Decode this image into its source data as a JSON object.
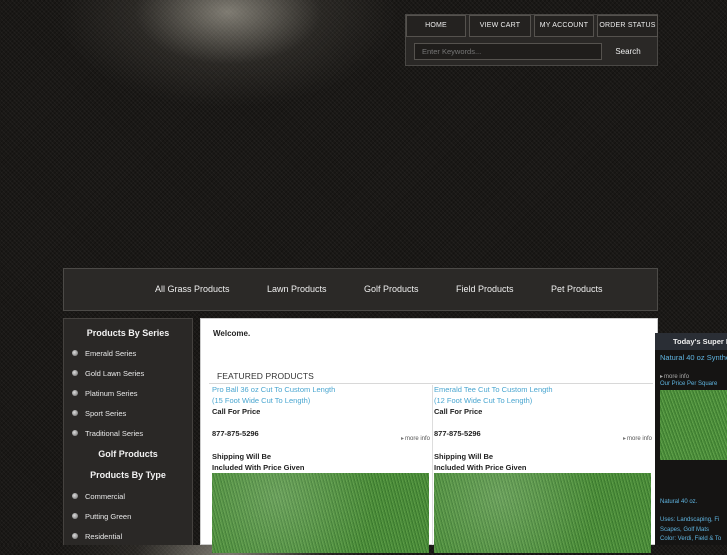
{
  "top_nav": {
    "home": "HOME",
    "view_cart": "VIEW CART",
    "my_account": "MY ACCOUNT",
    "order_status": "ORDER STATUS",
    "search_placeholder": "Enter Keywords...",
    "search_button": "Search"
  },
  "categories": [
    "All Grass Products",
    "Lawn Products",
    "Golf Products",
    "Field Products",
    "Pet Products"
  ],
  "sidebar": {
    "series_header": "Products By Series",
    "series": [
      "Emerald Series",
      "Gold Lawn Series",
      "Platinum Series",
      "Sport Series",
      "Traditional Series"
    ],
    "golf_header": "Golf Products",
    "type_header": "Products By Type",
    "types": [
      "Commercial",
      "Putting Green",
      "Residential"
    ]
  },
  "main": {
    "welcome": "Welcome.",
    "featured_title": "FEATURED PRODUCTS",
    "products": [
      {
        "name_line1": "Pro Ball 36 oz Cut To Custom Length",
        "name_line2": "(15 Foot Wide Cut To Length)",
        "price": "Call For Price",
        "phone": "877-875-5296",
        "more": "more info",
        "ship_line1": "Shipping Will Be",
        "ship_line2": "Included With Price Given"
      },
      {
        "name_line1": "Emerald Tee Cut To Custom Length",
        "name_line2": "(12 Foot Wide Cut To Length)",
        "price": "Call For Price",
        "phone": "877-875-5296",
        "more": "more info",
        "ship_line1": "Shipping Will Be",
        "ship_line2": "Included With Price Given"
      }
    ]
  },
  "deal": {
    "header": "Today's Super D",
    "name": "Natural 40 oz Synthe",
    "more": "more info",
    "price_label": "Our Price Per Square",
    "caption": "Natural 40 oz.",
    "uses": "Uses: Landscaping, Fi",
    "scapes": "Scapes, Golf Mats",
    "color": "Color: Verdi, Field & To"
  },
  "colors": {
    "link_blue": "#4aa6d0",
    "page_bg": "#1a1816",
    "panel_bg": "#2a2826"
  }
}
